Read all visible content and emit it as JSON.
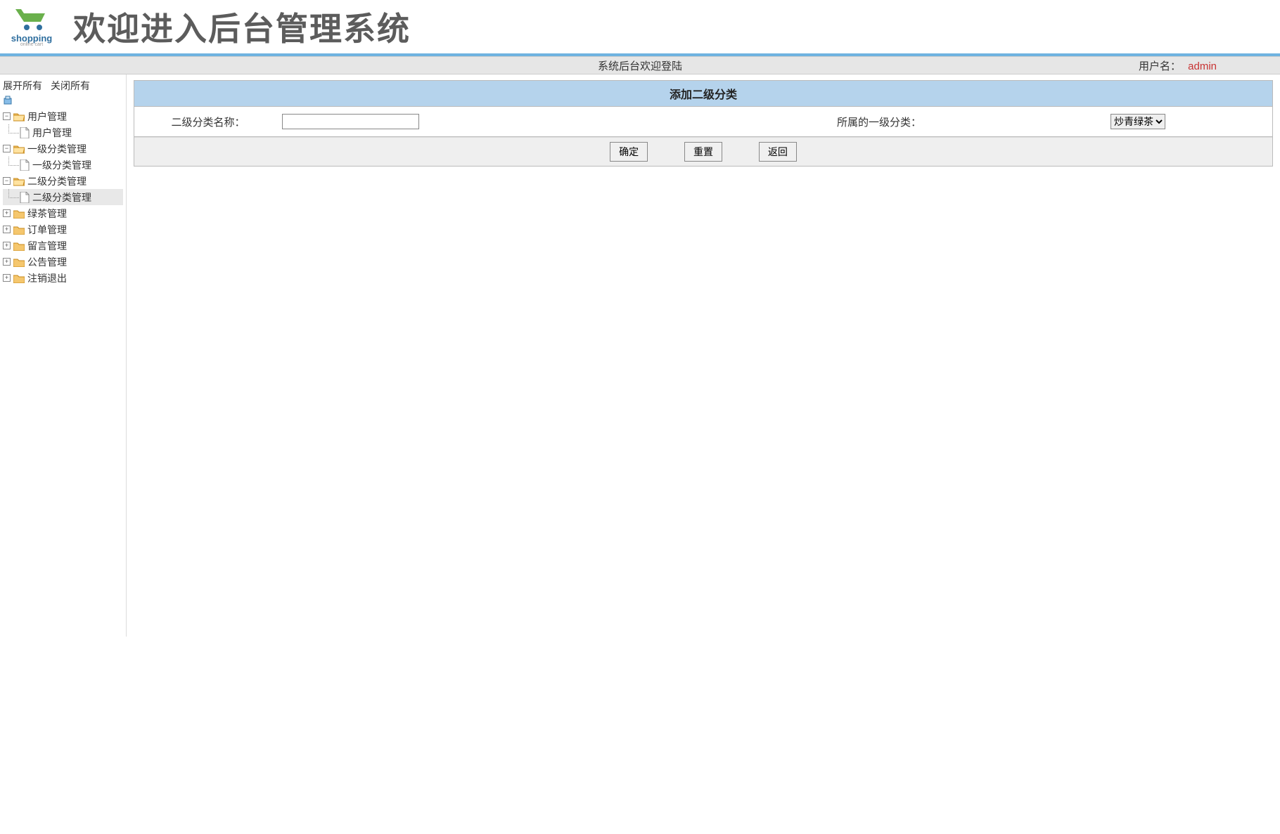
{
  "header": {
    "logo_text1": "shopping",
    "logo_text2": "online cart",
    "title": "欢迎进入后台管理系统"
  },
  "info_bar": {
    "welcome": "系统后台欢迎登陆",
    "user_label": "用户名：",
    "user_name": "admin"
  },
  "sidebar": {
    "expand_all": "展开所有",
    "collapse_all": "关闭所有",
    "nodes": [
      {
        "label": "用户管理",
        "expanded": true,
        "children": [
          {
            "label": "用户管理",
            "selected": false
          }
        ]
      },
      {
        "label": "一级分类管理",
        "expanded": true,
        "children": [
          {
            "label": "一级分类管理",
            "selected": false
          }
        ]
      },
      {
        "label": "二级分类管理",
        "expanded": true,
        "children": [
          {
            "label": "二级分类管理",
            "selected": true
          }
        ]
      },
      {
        "label": "绿茶管理",
        "expanded": false
      },
      {
        "label": "订单管理",
        "expanded": false
      },
      {
        "label": "留言管理",
        "expanded": false
      },
      {
        "label": "公告管理",
        "expanded": false
      },
      {
        "label": "注销退出",
        "expanded": false
      }
    ]
  },
  "main": {
    "panel_title": "添加二级分类",
    "label_name": "二级分类名称：",
    "input_value": "",
    "label_parent": "所属的一级分类：",
    "select_options": [
      "炒青绿茶"
    ],
    "select_value": "炒青绿茶",
    "btn_ok": "确定",
    "btn_reset": "重置",
    "btn_back": "返回"
  }
}
